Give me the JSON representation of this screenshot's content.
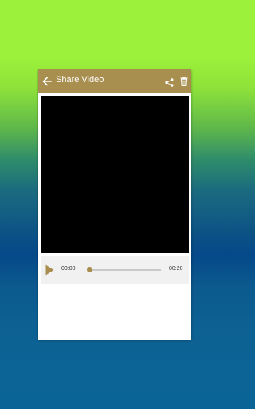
{
  "toolbar": {
    "title": "Share Video",
    "icons": [
      "back-arrow-icon",
      "share-icon",
      "delete-icon"
    ],
    "color": "#a88e4f"
  },
  "player": {
    "current_time": "00:00",
    "total_time": "00:20",
    "progress_fraction": 0.0,
    "play_icon": "play-icon",
    "accent_color": "#a88e4f"
  }
}
